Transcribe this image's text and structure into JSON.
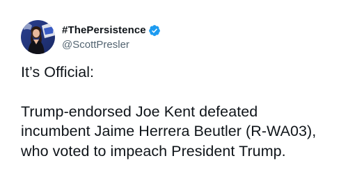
{
  "tweet": {
    "display_name": "#ThePersistence",
    "handle": "@ScottPresler",
    "verified": true,
    "avatar_icon": "avatar-photo",
    "verified_icon": "verified-badge-icon",
    "paragraph_1": "It’s Official:",
    "paragraph_2": "Trump-endorsed Joe Kent defeated\nincumbent Jaime Herrera Beutler (R-WA03),\nwho voted to impeach President Trump."
  },
  "colors": {
    "text_primary": "#0f1419",
    "text_secondary": "#536471",
    "verified_blue": "#1d9bf0",
    "background": "#ffffff"
  }
}
